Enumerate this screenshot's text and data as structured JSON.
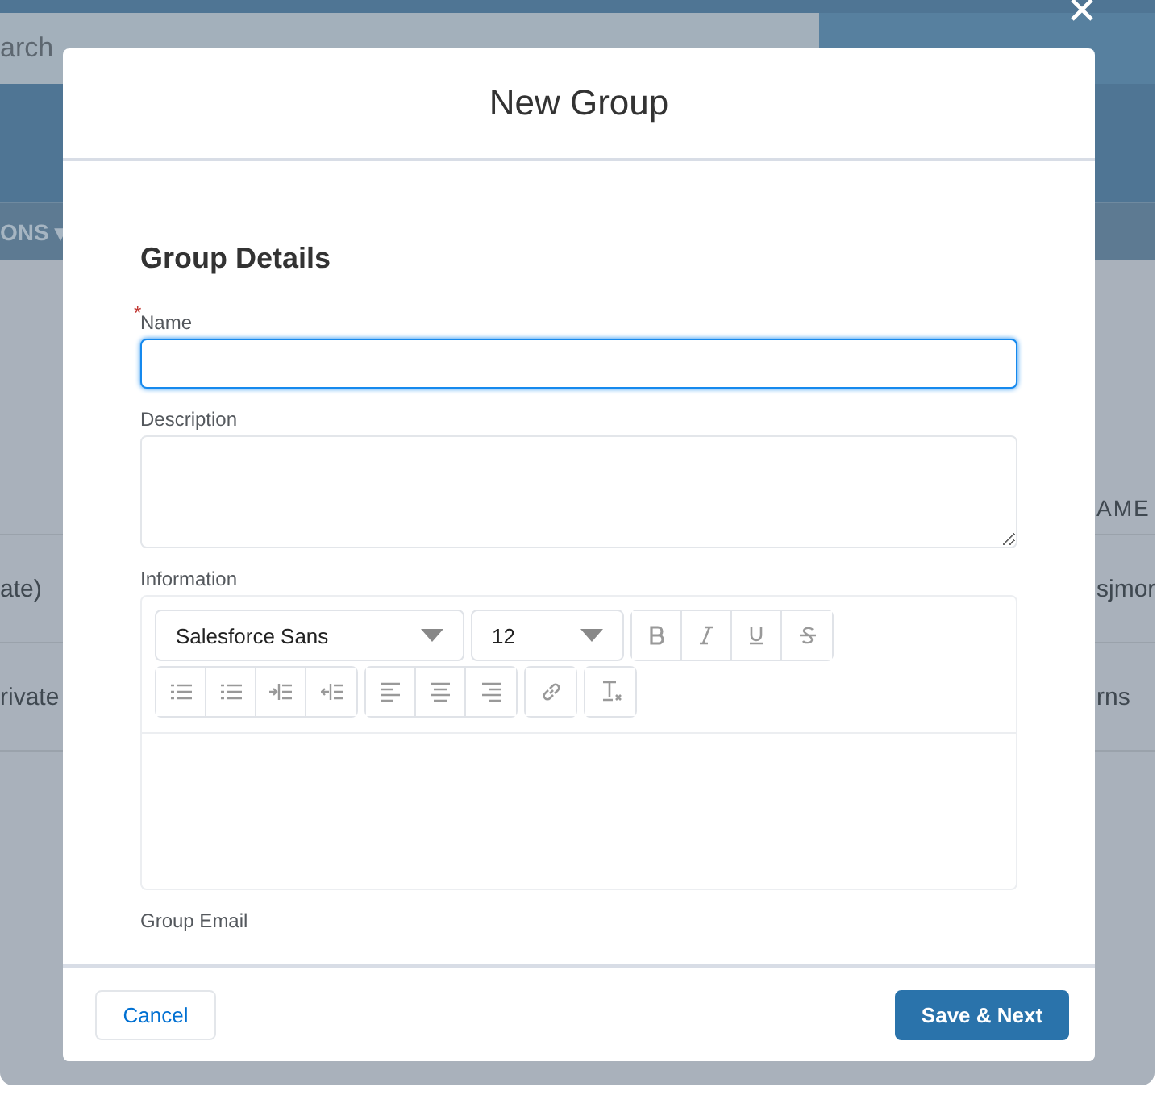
{
  "background": {
    "search_text": "arch",
    "nav_label": "ONS ▾",
    "column_header": "AME",
    "rows": [
      {
        "column_1": "ate)",
        "column_2": "sjmor"
      },
      {
        "column_1": "rivate",
        "column_2": "rns"
      }
    ]
  },
  "modal": {
    "title": "New Group",
    "section_title": "Group Details",
    "fields": [
      {
        "kind": "input",
        "label": "Name",
        "required_mark": "*",
        "focused": true
      },
      {
        "kind": "textarea",
        "label": "Description"
      },
      {
        "kind": "editor",
        "label": "Information",
        "font": "Salesforce Sans",
        "size": "12"
      },
      {
        "kind": "partial",
        "label": "Group Email"
      }
    ],
    "buttons": [
      {
        "label": "Cancel",
        "kind": "neutral"
      },
      {
        "label": "Save & Next",
        "kind": "brand"
      }
    ]
  }
}
